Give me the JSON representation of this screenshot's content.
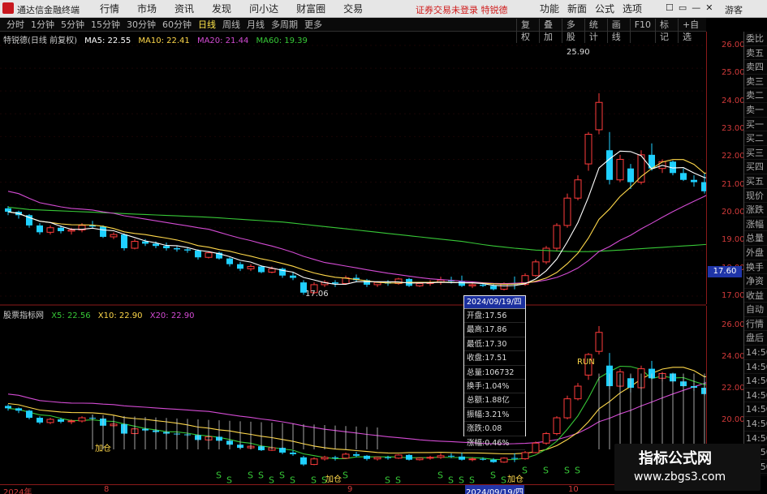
{
  "app": {
    "name": "通达信金融终端"
  },
  "menu": [
    "行情",
    "市场",
    "资讯",
    "发现",
    "问小达",
    "财富圈",
    "交易"
  ],
  "notice": "证券交易未登录  特锐德",
  "right_menu": [
    "功能",
    "新面",
    "公式",
    "选项"
  ],
  "window_controls": [
    "☐",
    "▭",
    "—",
    "✕"
  ],
  "guest": "游客",
  "periods": [
    "分时",
    "1分钟",
    "5分钟",
    "15分钟",
    "30分钟",
    "60分钟",
    "日线",
    "周线",
    "月线",
    "多周期",
    "更多"
  ],
  "active_period": "日线",
  "chart_tools": [
    "复权",
    "叠加",
    "多股",
    "统计",
    "画线",
    "F10",
    "标记",
    "+自选"
  ],
  "main_legend": {
    "name": "特锐德(日线 前复权)",
    "ma5": "MA5: 22.55",
    "ma10": "MA10: 22.41",
    "ma20": "MA20: 21.44",
    "ma60": "MA60: 19.39"
  },
  "sub_legend": {
    "name": "股票指标网",
    "x5": "X5: 22.56",
    "x10": "X10: 22.90",
    "x20": "X20: 22.90"
  },
  "price_axis": [
    "26.00",
    "25.00",
    "24.00",
    "23.00",
    "22.00",
    "21.00",
    "20.00",
    "19.00",
    "18.00",
    "17.00"
  ],
  "current_price": "17.60",
  "ind_axis": [
    "26.00",
    "24.00",
    "22.00",
    "20.00"
  ],
  "annotations": {
    "high": "25.90",
    "low": "17.06"
  },
  "sub_marks": {
    "add": "加仓",
    "run": "RUN",
    "s": "S"
  },
  "right_panel": [
    "委比",
    "卖五",
    "卖四",
    "卖三",
    "卖二",
    "卖一",
    "买一",
    "买二",
    "买三",
    "买四",
    "买五",
    "现价",
    "涨跌",
    "涨幅",
    "总量",
    "外盘",
    "换手",
    "净资",
    "收益",
    "自动",
    "行情",
    "盘后",
    "14:50",
    "14:50",
    "14:50",
    "14:50",
    "14:50",
    "14:50",
    "14:50",
    "14:50",
    "14:50"
  ],
  "xaxis": {
    "y2024": "2024年",
    "m8": "8",
    "m9": "9",
    "sel": "2024/09/19/四",
    "m10": "10"
  },
  "tooltip": {
    "date": "2024/09/19/四",
    "rows": [
      "开盘:17.56",
      "最高:17.86",
      "最低:17.30",
      "收盘:17.51",
      "总量:106732",
      "换手:1.04%",
      "总额:1.88亿",
      "振幅:3.21%",
      "涨跌:0.08",
      "涨幅:0.46%"
    ]
  },
  "watermark": {
    "title": "指标公式网",
    "url": "www.zbgs3.com"
  },
  "colors": {
    "up": "#ff3b3b",
    "down": "#1fd0ff",
    "ma5": "#ffffff",
    "ma10": "#ffd84a",
    "ma20": "#d34bd3",
    "ma60": "#37c837",
    "axis": "#d23a3a"
  },
  "chart_data": {
    "type": "candlestick",
    "ylim": [
      16.5,
      28.4
    ],
    "candles": [
      [
        20.85,
        20.95,
        20.55,
        20.7
      ],
      [
        20.7,
        20.75,
        20.4,
        20.55
      ],
      [
        20.55,
        20.6,
        20.0,
        20.1
      ],
      [
        20.1,
        20.2,
        19.7,
        19.8
      ],
      [
        19.8,
        20.1,
        19.7,
        20.0
      ],
      [
        20.0,
        20.1,
        19.75,
        19.85
      ],
      [
        19.85,
        20.0,
        19.7,
        19.9
      ],
      [
        19.9,
        20.2,
        19.8,
        20.1
      ],
      [
        20.1,
        20.3,
        19.95,
        20.05
      ],
      [
        20.05,
        20.1,
        19.55,
        19.6
      ],
      [
        19.6,
        19.8,
        19.5,
        19.7
      ],
      [
        19.7,
        19.75,
        19.0,
        19.1
      ],
      [
        19.1,
        19.5,
        19.05,
        19.4
      ],
      [
        19.4,
        19.5,
        19.2,
        19.3
      ],
      [
        19.3,
        19.4,
        19.1,
        19.2
      ],
      [
        19.2,
        19.35,
        19.0,
        19.1
      ],
      [
        19.1,
        19.2,
        18.95,
        19.05
      ],
      [
        19.05,
        19.15,
        18.9,
        19.0
      ],
      [
        19.0,
        19.05,
        18.6,
        18.7
      ],
      [
        18.7,
        18.95,
        18.65,
        18.9
      ],
      [
        18.9,
        18.95,
        18.6,
        18.65
      ],
      [
        18.65,
        18.7,
        18.3,
        18.4
      ],
      [
        18.4,
        18.5,
        18.1,
        18.2
      ],
      [
        18.2,
        18.4,
        18.1,
        18.3
      ],
      [
        18.3,
        18.35,
        18.0,
        18.05
      ],
      [
        18.05,
        18.3,
        18.0,
        18.2
      ],
      [
        18.2,
        18.25,
        17.8,
        17.9
      ],
      [
        17.9,
        18.05,
        17.7,
        17.8
      ],
      [
        17.6,
        17.7,
        17.06,
        17.15
      ],
      [
        17.15,
        17.6,
        17.1,
        17.5
      ],
      [
        17.5,
        17.7,
        17.4,
        17.6
      ],
      [
        17.6,
        17.7,
        17.4,
        17.55
      ],
      [
        17.55,
        17.9,
        17.5,
        17.8
      ],
      [
        17.8,
        17.95,
        17.6,
        17.7
      ],
      [
        17.7,
        17.75,
        17.4,
        17.5
      ],
      [
        17.5,
        17.65,
        17.4,
        17.6
      ],
      [
        17.6,
        17.7,
        17.45,
        17.55
      ],
      [
        17.55,
        17.8,
        17.5,
        17.75
      ],
      [
        17.75,
        17.8,
        17.4,
        17.45
      ],
      [
        17.45,
        17.6,
        17.4,
        17.55
      ],
      [
        17.55,
        17.7,
        17.45,
        17.6
      ],
      [
        17.6,
        17.85,
        17.5,
        17.7
      ],
      [
        17.7,
        17.85,
        17.55,
        17.65
      ],
      [
        17.65,
        17.9,
        17.4,
        17.45
      ],
      [
        17.45,
        17.6,
        17.35,
        17.5
      ],
      [
        17.5,
        17.6,
        17.4,
        17.45
      ],
      [
        17.45,
        17.55,
        17.25,
        17.3
      ],
      [
        17.3,
        17.6,
        17.25,
        17.55
      ],
      [
        17.56,
        17.86,
        17.3,
        17.51
      ],
      [
        17.51,
        18.0,
        17.45,
        17.9
      ],
      [
        17.9,
        18.6,
        17.85,
        18.5
      ],
      [
        18.5,
        19.2,
        18.4,
        19.1
      ],
      [
        19.1,
        20.2,
        19.0,
        20.1
      ],
      [
        20.1,
        21.5,
        20.0,
        21.3
      ],
      [
        21.3,
        22.3,
        21.2,
        22.1
      ],
      [
        22.8,
        24.2,
        22.5,
        24.1
      ],
      [
        24.3,
        25.9,
        24.1,
        25.5
      ],
      [
        23.4,
        24.2,
        21.9,
        22.1
      ],
      [
        22.1,
        23.2,
        22.0,
        23.0
      ],
      [
        22.6,
        22.8,
        21.7,
        22.0
      ],
      [
        22.0,
        23.4,
        21.9,
        23.2
      ],
      [
        23.2,
        23.7,
        22.5,
        22.6
      ],
      [
        22.6,
        23.0,
        22.4,
        22.9
      ],
      [
        22.9,
        22.95,
        22.3,
        22.4
      ],
      [
        22.4,
        22.6,
        22.05,
        22.1
      ],
      [
        22.1,
        22.3,
        21.8,
        22.0
      ],
      [
        22.0,
        22.4,
        21.5,
        21.6
      ],
      [
        21.6,
        23.0,
        21.6,
        22.7
      ],
      [
        22.7,
        22.9,
        22.3,
        22.8
      ],
      [
        22.8,
        22.9,
        22.5,
        22.6
      ],
      [
        22.6,
        22.8,
        22.4,
        22.7
      ],
      [
        22.7,
        22.9,
        22.6,
        22.8
      ],
      [
        22.8,
        22.95,
        22.3,
        22.4
      ],
      [
        22.4,
        22.95,
        22.35,
        22.9
      ],
      [
        22.9,
        22.95,
        22.4,
        22.5
      ]
    ],
    "ma60": [
      20.9,
      20.85,
      20.8,
      20.78,
      20.76,
      20.74,
      20.72,
      20.7,
      20.68,
      20.66,
      20.64,
      20.62,
      20.6,
      20.58,
      20.56,
      20.54,
      20.52,
      20.5,
      20.48,
      20.46,
      20.43,
      20.4,
      20.37,
      20.34,
      20.31,
      20.28,
      20.25,
      20.2,
      20.15,
      20.1,
      20.05,
      20.0,
      19.95,
      19.9,
      19.85,
      19.8,
      19.75,
      19.7,
      19.65,
      19.6,
      19.55,
      19.5,
      19.45,
      19.4,
      19.33,
      19.26,
      19.2,
      19.15,
      19.1,
      19.06,
      19.02,
      19.0,
      18.98,
      18.96,
      18.95,
      18.95,
      18.97,
      18.99,
      19.02,
      19.05,
      19.08,
      19.11,
      19.14,
      19.17,
      19.2,
      19.23,
      19.26,
      19.29,
      19.32,
      19.34,
      19.36,
      19.37,
      19.38,
      19.39,
      19.39
    ]
  }
}
